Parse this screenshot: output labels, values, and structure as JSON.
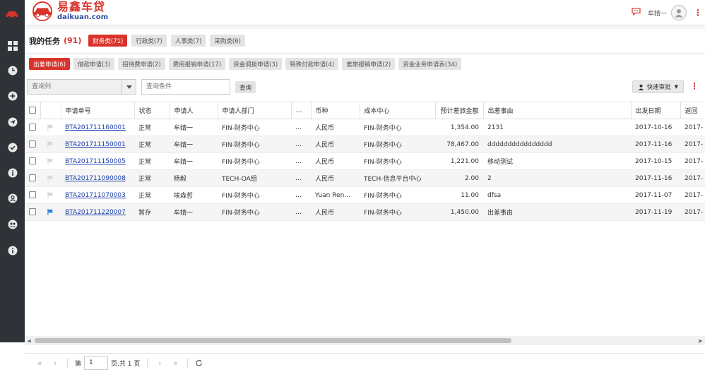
{
  "brand": {
    "name_cn": "易鑫车贷",
    "name_en": "daikuan.com",
    "accent": "#d9342b"
  },
  "header": {
    "username": "牟婧一",
    "icons": [
      "chat-icon",
      "avatar-icon",
      "more-icon"
    ]
  },
  "sidebar": {
    "icons": [
      "car-icon",
      "dashboard-icon",
      "clock-icon",
      "plus-icon",
      "send-icon",
      "check-icon",
      "info-icon",
      "user-icon",
      "group-icon",
      "info-icon"
    ]
  },
  "tasks": {
    "title": "我的任务",
    "count": "(91)",
    "tabs": [
      {
        "label": "财务类(71)",
        "active": true
      },
      {
        "label": "行政类(7)",
        "active": false
      },
      {
        "label": "人事类(7)",
        "active": false
      },
      {
        "label": "采购类(6)",
        "active": false
      }
    ]
  },
  "subtabs": [
    {
      "label": "出差申请(6)",
      "active": true
    },
    {
      "label": "借款申请(3)",
      "active": false
    },
    {
      "label": "招待费申请(2)",
      "active": false
    },
    {
      "label": "费用报销申请(17)",
      "active": false
    },
    {
      "label": "资金调拨申请(3)",
      "active": false
    },
    {
      "label": "特殊付款申请(4)",
      "active": false
    },
    {
      "label": "差旅报销申请(2)",
      "active": false
    },
    {
      "label": "资金业务申请表(34)",
      "active": false
    }
  ],
  "search": {
    "column_placeholder": "查询列",
    "condition_placeholder": "查询条件",
    "query_label": "查询",
    "fast_approve_label": "快速审批"
  },
  "table": {
    "columns": [
      "申请单号",
      "状态",
      "申请人",
      "申请人部门",
      "…",
      "币种",
      "成本中心",
      "预计差旅金额",
      "出差事由",
      "出发日期",
      "返回"
    ],
    "rows": [
      {
        "no": "BTA201711160001",
        "status": "正常",
        "applicant": "牟婧一",
        "dept": "FIN-财务中心",
        "more": "…",
        "currency": "人民币",
        "cost": "FIN-财务中心",
        "amount": "1,354.00",
        "reason": "2131",
        "date": "2017-10-16",
        "ret": "2017-",
        "flag": false
      },
      {
        "no": "BTA201711150001",
        "status": "正常",
        "applicant": "牟婧一",
        "dept": "FIN-财务中心",
        "more": "…",
        "currency": "人民币",
        "cost": "FIN-财务中心",
        "amount": "78,467.00",
        "reason": "dddddddddddddddd",
        "date": "2017-11-16",
        "ret": "2017-",
        "flag": false
      },
      {
        "no": "BTA201711150005",
        "status": "正常",
        "applicant": "牟婧一",
        "dept": "FIN-财务中心",
        "more": "…",
        "currency": "人民币",
        "cost": "FIN-财务中心",
        "amount": "1,221.00",
        "reason": "移动测试",
        "date": "2017-10-15",
        "ret": "2017-",
        "flag": false
      },
      {
        "no": "BTA201711090008",
        "status": "正常",
        "applicant": "杨毅",
        "dept": "TECH-OA组",
        "more": "…",
        "currency": "人民币",
        "cost": "TECH-信息平台中心",
        "amount": "2.00",
        "reason": "2",
        "date": "2017-11-16",
        "ret": "2017-",
        "flag": false
      },
      {
        "no": "BTA201711070003",
        "status": "正常",
        "applicant": "埃森哲",
        "dept": "FIN-财务中心",
        "more": "…",
        "currency": "Yuan Ren…",
        "cost": "FIN-财务中心",
        "amount": "11.00",
        "reason": "dfsa",
        "date": "2017-11-07",
        "ret": "2017-",
        "flag": false
      },
      {
        "no": "BTA201711220007",
        "status": "暂存",
        "applicant": "牟婧一",
        "dept": "FIN-财务中心",
        "more": "…",
        "currency": "人民币",
        "cost": "FIN-财务中心",
        "amount": "1,450.00",
        "reason": "出差事由",
        "date": "2017-11-19",
        "ret": "2017-",
        "flag": true
      }
    ]
  },
  "pager": {
    "page_label": "第",
    "page_value": "1",
    "total_label": "页,共 1 页"
  },
  "colors": {
    "link": "#1a3fa8",
    "flag": "#2f7fd6",
    "sidebar": "#2f3237"
  }
}
